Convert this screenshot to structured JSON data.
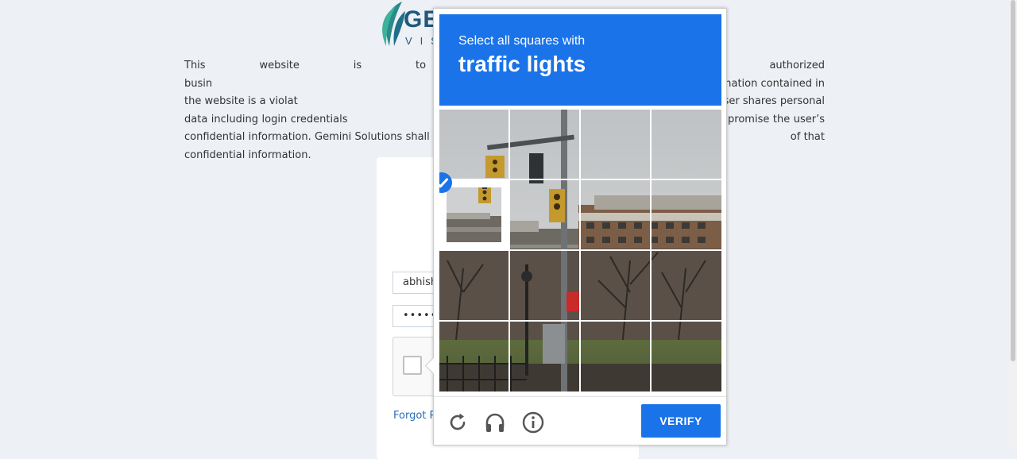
{
  "logo": {
    "brand": "GE",
    "brand_sub": "VIS"
  },
  "notice": {
    "text": "This website is to be used only for authorized busin                                                                                                           orized distribution of any information contained in the website is a violat                                                                                                      is monitored. If user shares personal data including login credentials                                                                                                        npromise the user’s confidential information. Gemini Solutions shall ha                                                                                                     of that confidential information."
  },
  "login": {
    "username_value": "abhish",
    "password_value": "•••••",
    "forgot_label": "Forgot Pa"
  },
  "captcha": {
    "instruction": "Select all squares with",
    "target": "traffic lights",
    "rows": 4,
    "cols": 4,
    "selected_tiles": [
      4
    ],
    "verify_label": "VERIFY"
  },
  "colors": {
    "accent": "#1a73e8",
    "link": "#2a6eb8",
    "brand": "#22587a",
    "page_bg": "#edf0f5"
  },
  "icons": {
    "reload": "reload-icon",
    "audio": "headphones-icon",
    "info": "info-icon"
  }
}
